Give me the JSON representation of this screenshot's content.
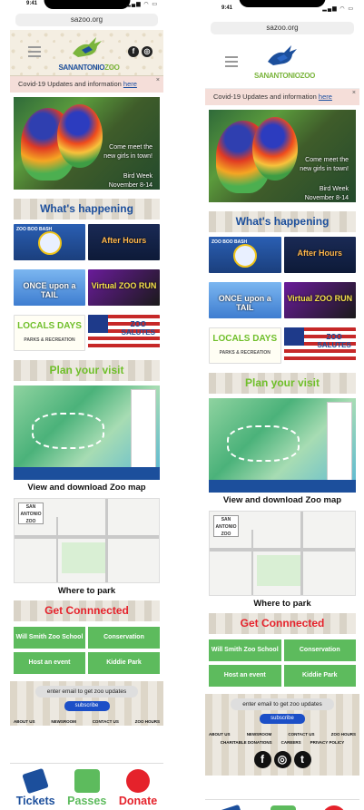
{
  "status": {
    "time": "9:41"
  },
  "browser": {
    "url": "sazoo.org"
  },
  "header": {
    "brand_part1": "SANANTONIO",
    "brand_part2": "ZOO"
  },
  "covid_banner": {
    "text": "Covid-19 Updates and information ",
    "link": "here",
    "close": "×"
  },
  "hero": {
    "line1": "Come meet the",
    "line2": "new girls in town!",
    "line3": "Bird Week",
    "line4": "November 8-14"
  },
  "sections": {
    "whats_happening": "What's happening",
    "plan_visit": "Plan your visit",
    "get_connected": "Get Connnected"
  },
  "events": [
    {
      "top": "ZOO BOO BASH",
      "big": "OCT 8"
    },
    {
      "top": "",
      "big": "After Hours"
    },
    {
      "top": "",
      "big": "ONCE upon a TAIL"
    },
    {
      "top": "",
      "big": "Virtual ZOO RUN"
    },
    {
      "top": "PARKS & RECREATION",
      "big": "LOCALS DAYS"
    },
    {
      "top": "",
      "big": "ZOO SALUTES"
    }
  ],
  "plan": {
    "map_caption": "View and download Zoo map",
    "park_caption": "Where to park",
    "street_logo": "SAN ANTONIO ZOO"
  },
  "connect_buttons": [
    "Will Smith Zoo School",
    "Conservation",
    "Host an event",
    "Kiddie Park"
  ],
  "footer": {
    "email_placeholder": "enter email to get zoo updates",
    "subscribe": "subscribe",
    "links": [
      "ABOUT US",
      "NEWSROOM",
      "CONTACT US",
      "ZOO HOURS"
    ],
    "links2": [
      "CHARITABLE DONATIONS",
      "CAREERS",
      "PRIVACY POLICY"
    ]
  },
  "bottom_nav": {
    "tickets": "Tickets",
    "passes": "Passes",
    "donate": "Donate"
  },
  "icons": {
    "facebook": "f",
    "instagram": "◎",
    "twitter": "t"
  }
}
